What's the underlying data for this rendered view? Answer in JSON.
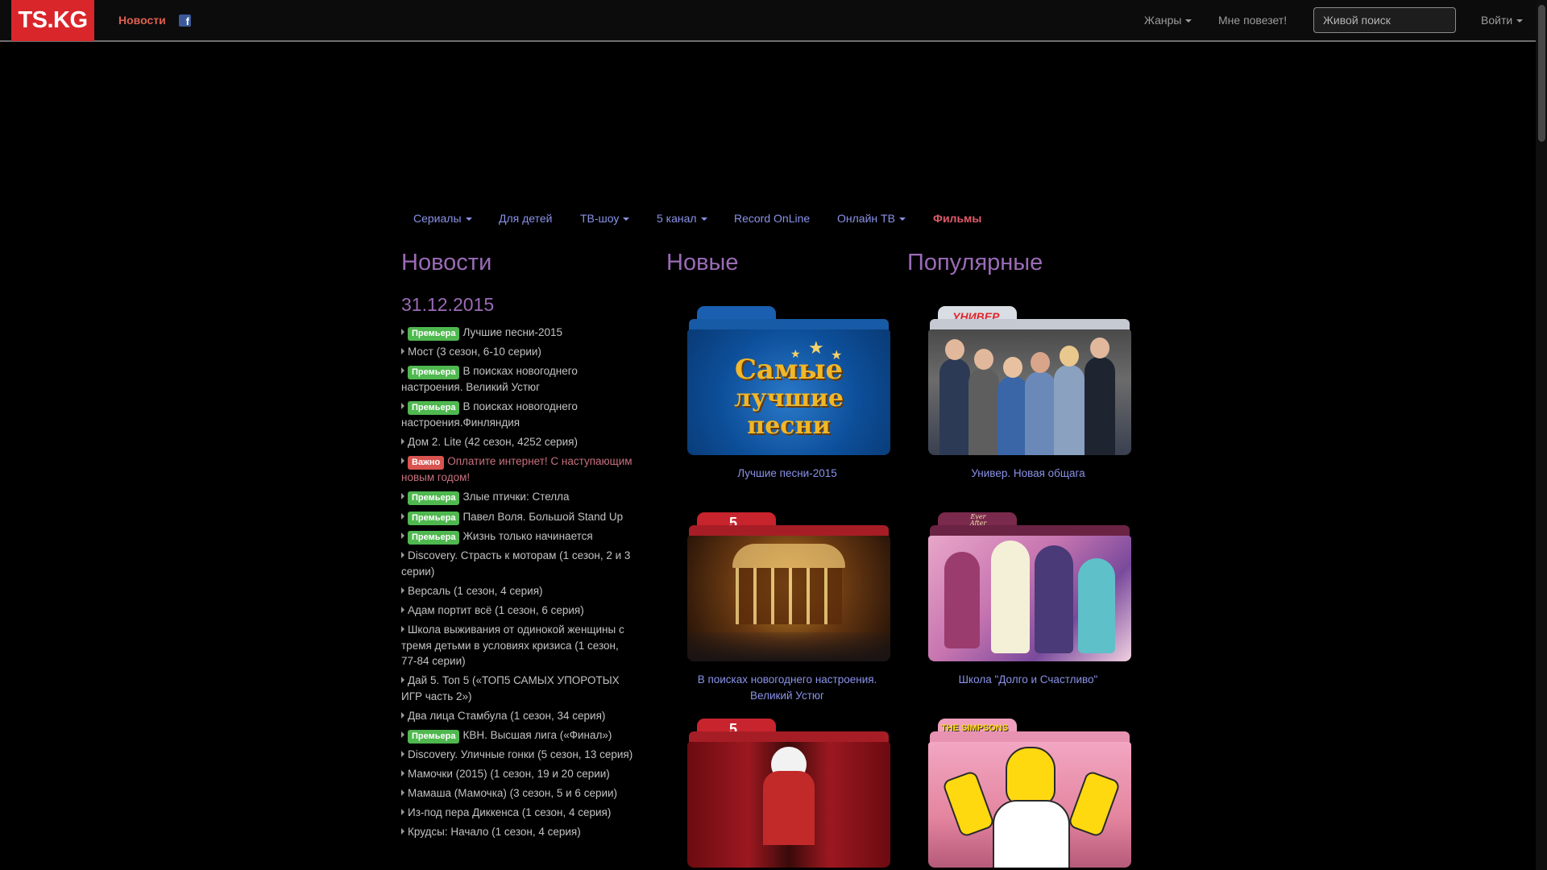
{
  "navbar": {
    "logo": "TS.KG",
    "news_link": "Новости",
    "facebook_icon": "facebook-icon",
    "genres": "Жанры",
    "lucky": "Мне повезет!",
    "search_placeholder": "Живой поиск",
    "login": "Войти"
  },
  "subnav": {
    "items": [
      "Сериалы",
      "Для детей",
      "ТВ-шоу",
      "5 канал",
      "Record OnLine",
      "Онлайн ТВ",
      "Фильмы"
    ]
  },
  "sections": {
    "news": "Новости",
    "new": "Новые",
    "popular": "Популярные"
  },
  "news": {
    "date": "31.12.2015",
    "items": [
      {
        "badge": "Премьера",
        "text": "Лучшие песни-2015"
      },
      {
        "badge": "",
        "text": "Мост (3 сезон, 6-10 серии)"
      },
      {
        "badge": "Премьера",
        "text": "В поисках новогоднего настроения. Великий Устюг"
      },
      {
        "badge": "Премьера",
        "text": "В поисках новогоднего настроения.Финляндия"
      },
      {
        "badge": "",
        "text": "Дом 2. Lite (42 сезон, 4252 серия)"
      },
      {
        "badge": "Важно",
        "text": "Оплатите интернет! С наступающим новым годом!"
      },
      {
        "badge": "Премьера",
        "text": "Злые птички: Стелла"
      },
      {
        "badge": "Премьера",
        "text": "Павел Воля. Большой Stand Up"
      },
      {
        "badge": "Премьера",
        "text": "Жизнь только начинается"
      },
      {
        "badge": "",
        "text": "Discovery. Страсть к моторам (1 сезон, 2 и 3 серии)"
      },
      {
        "badge": "",
        "text": "Версаль (1 сезон, 4 серия)"
      },
      {
        "badge": "",
        "text": "Адам портит всё (1 сезон, 6 серия)"
      },
      {
        "badge": "",
        "text": "Школа выживания от одинокой женщины с тремя детьми в условиях кризиса (1 сезон, 77-84 серии)"
      },
      {
        "badge": "",
        "text": "Дай 5. Топ 5 («ТОП5 САМЫХ УПОРОТЫХ ИГР часть 2»)"
      },
      {
        "badge": "",
        "text": "Два лица Стамбула (1 сезон, 34 серия)"
      },
      {
        "badge": "Премьера",
        "text": "КВН. Высшая лига («Финал»)"
      },
      {
        "badge": "",
        "text": "Discovery. Уличные гонки (5 сезон, 13 серия)"
      },
      {
        "badge": "",
        "text": "Мамочки (2015) (1 сезон, 19 и 20 серии)"
      },
      {
        "badge": "",
        "text": "Мамаша (Мамочка) (3 сезон, 5 и 6 серии)"
      },
      {
        "badge": "",
        "text": "Из-под пера Диккенса (1 сезон, 4 серия)"
      },
      {
        "badge": "",
        "text": "Крудсы: Начало (1 сезон, 4 серия)"
      }
    ]
  },
  "new_cards": [
    {
      "caption": "Лучшие песни-2015",
      "folder_color": "#1a6fc0",
      "art_text": [
        "Самые",
        "лучшие",
        "песни"
      ]
    },
    {
      "caption": "В поисках новогоднего настроения. Великий Устюг",
      "folder_color": "#c8242d",
      "tab_label": "5"
    },
    {
      "caption": "",
      "folder_color": "#c8242d",
      "tab_label": "5"
    }
  ],
  "popular_cards": [
    {
      "caption": "Универ. Новая общага",
      "folder_color": "#cfd4dc",
      "tab_label": "УНИВЕР"
    },
    {
      "caption": "Школа \"Долго и Счастливо\"",
      "folder_color": "#7a2a4c",
      "tab_label": "Ever After High"
    },
    {
      "caption": "",
      "folder_color": "#f2a6c2",
      "tab_label": "THE SIMPSONS"
    }
  ],
  "colors": {
    "background": "#000000",
    "logo_red": "#d9262b",
    "link": "#8a92e8",
    "heading": "#9a6bb6",
    "badge_green": "#4fb84f",
    "badge_red": "#d9534f"
  }
}
